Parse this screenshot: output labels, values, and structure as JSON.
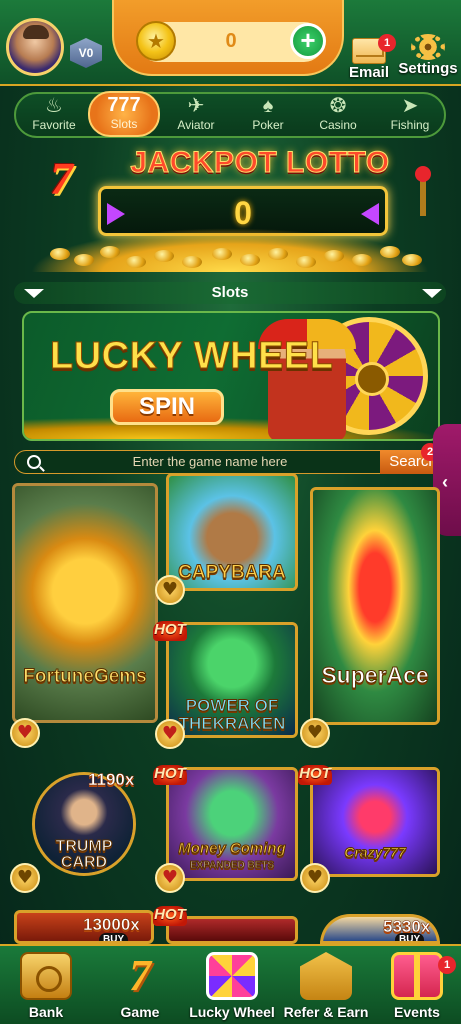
{
  "header": {
    "balance": "0",
    "vip_label": "V0",
    "email_label": "Email",
    "email_badge": "1",
    "settings_label": "Settings"
  },
  "categories": [
    {
      "label": "Favorite",
      "icon": "flame-icon",
      "glyph": "♨"
    },
    {
      "label": "Slots",
      "icon": "slots-777-icon",
      "glyph": "777",
      "active": true
    },
    {
      "label": "Aviator",
      "icon": "rocket-icon",
      "glyph": "✈"
    },
    {
      "label": "Poker",
      "icon": "cards-icon",
      "glyph": "♠"
    },
    {
      "label": "Casino",
      "icon": "roulette-icon",
      "glyph": "❂"
    },
    {
      "label": "Fishing",
      "icon": "fish-icon",
      "glyph": "➤"
    }
  ],
  "jackpot": {
    "title": "JACKPOT LOTTO",
    "value": "0"
  },
  "section": {
    "title": "Slots"
  },
  "banner": {
    "title": "LUCKY WHEEL",
    "button": "SPIN"
  },
  "search": {
    "placeholder": "Enter the game name here",
    "button": "Search",
    "badge": "2"
  },
  "games": [
    {
      "title": "FortuneGems",
      "favorited": true
    },
    {
      "title": "CAPYBARA",
      "favorited": false
    },
    {
      "title": "POWER OF THEKRAKEN",
      "favorited": true,
      "hot": "HOT"
    },
    {
      "title": "SuperAce",
      "favorited": false
    },
    {
      "title": "TRUMP CARD",
      "multiplier": "1190x",
      "favorited": false
    },
    {
      "title": "Money Coming",
      "subtitle": "EXPANDED BETS",
      "hot": "HOT",
      "favorited": true
    },
    {
      "title": "Crazy777",
      "hot": "HOT",
      "favorited": false
    },
    {
      "multiplier": "13000x",
      "buy": "BUY"
    },
    {
      "hot": "HOT"
    },
    {
      "multiplier": "5330x",
      "buy": "BUY"
    }
  ],
  "bottom_nav": [
    {
      "label": "Bank",
      "icon": "bank-icon"
    },
    {
      "label": "Game",
      "icon": "game-777-icon",
      "active": true
    },
    {
      "label": "Lucky Wheel",
      "icon": "lucky-wheel-icon"
    },
    {
      "label": "Refer & Earn",
      "icon": "refer-envelope-icon"
    },
    {
      "label": "Events",
      "icon": "gift-icon",
      "badge": "1"
    }
  ],
  "colors": {
    "background": "#0c3d22",
    "accent_orange": "#e8741a",
    "gold": "#d9a623",
    "hot_red": "#c21806"
  }
}
